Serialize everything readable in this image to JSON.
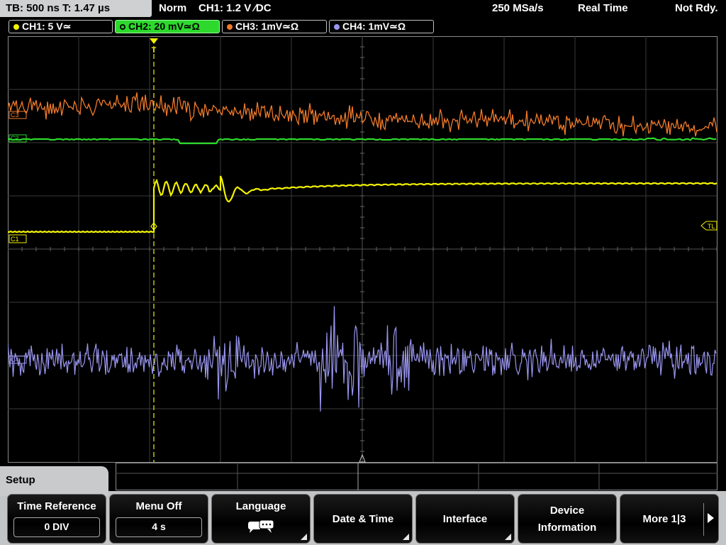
{
  "status_bar": {
    "timebase": "TB: 500 ns  T: 1.47 µs",
    "mode": "Norm",
    "trigger": "CH1: 1.2 V ∕DC",
    "sample_rate": "250 MSa/s",
    "acq_mode": "Real Time",
    "state": "Not Rdy."
  },
  "channels": [
    {
      "label": "CH1: 5 V≃",
      "color": "#f2f200"
    },
    {
      "label": "CH2: 20 mV≃Ω",
      "color": "#2cd92c"
    },
    {
      "label": "CH3: 1mV≃Ω",
      "color": "#f07a2a"
    },
    {
      "label": "CH4: 1mV≃Ω",
      "color": "#9a96f0"
    }
  ],
  "markers": {
    "trigger_level": "TL",
    "ch1": "C1",
    "ch2": "C2",
    "ch3": "C3",
    "ch4": "C4",
    "trigger_pos": "T"
  },
  "menu": {
    "title": "Setup",
    "softkeys": [
      {
        "label": "Time Reference",
        "value": "0 DIV"
      },
      {
        "label": "Menu Off",
        "value": "4 s"
      },
      {
        "label": "Language",
        "icon": "speech-bubbles-icon"
      },
      {
        "label": "Date & Time"
      },
      {
        "label": "Interface"
      },
      {
        "label_line1": "Device",
        "label_line2": "Information"
      },
      {
        "label": "More 1|3"
      }
    ]
  }
}
